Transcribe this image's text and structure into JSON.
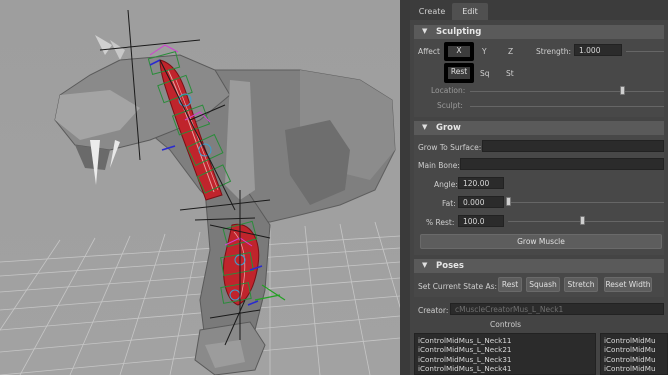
{
  "tabs": [
    {
      "label": "Create",
      "active": false
    },
    {
      "label": "Edit",
      "active": true
    }
  ],
  "sculpting": {
    "title": "Sculpting",
    "affect_label": "Affect",
    "axis_x": "X",
    "axis_y": "Y",
    "axis_z": "Z",
    "strength_label": "Strength:",
    "strength_value": "1.000",
    "rest_label": "Rest",
    "sq_label": "Sq",
    "st_label": "St",
    "location_label": "Location:",
    "sculpt_label": "Sculpt:"
  },
  "grow": {
    "title": "Grow",
    "grow_to_surface_label": "Grow To Surface:",
    "grow_to_surface_value": "",
    "main_bone_label": "Main Bone:",
    "main_bone_value": "",
    "angle_label": "Angle:",
    "angle_value": "120.00",
    "fat_label": "Fat:",
    "fat_value": "0.000",
    "rest_label": "% Rest:",
    "rest_value": "100.0",
    "grow_button": "Grow Muscle"
  },
  "poses": {
    "title": "Poses",
    "set_state_label": "Set Current State As:",
    "buttons": [
      "Rest",
      "Squash",
      "Stretch",
      "Reset Width"
    ]
  },
  "creator": {
    "label": "Creator:",
    "value": "cMuscleCreatorMus_L_Neck1",
    "controls_label": "Controls"
  },
  "controls_list": [
    "iControlMidMus_L_Neck11",
    "iControlMidMus_L_Neck21",
    "iControlMidMus_L_Neck31",
    "iControlMidMus_L_Neck41"
  ],
  "controls_list_right": [
    "iControlMidMu",
    "iControlMidMu",
    "iControlMidMu",
    "iControlMidMu"
  ],
  "colors": {
    "viewport_bg": "#a0a0a0",
    "grid": "#c8c8c8",
    "muscle_red": "#c0242c",
    "panel_bg": "#444444",
    "section_header": "#5a5a5a",
    "field_bg": "#2b2b2b"
  },
  "icons": [
    "collapse-arrow-icon"
  ]
}
